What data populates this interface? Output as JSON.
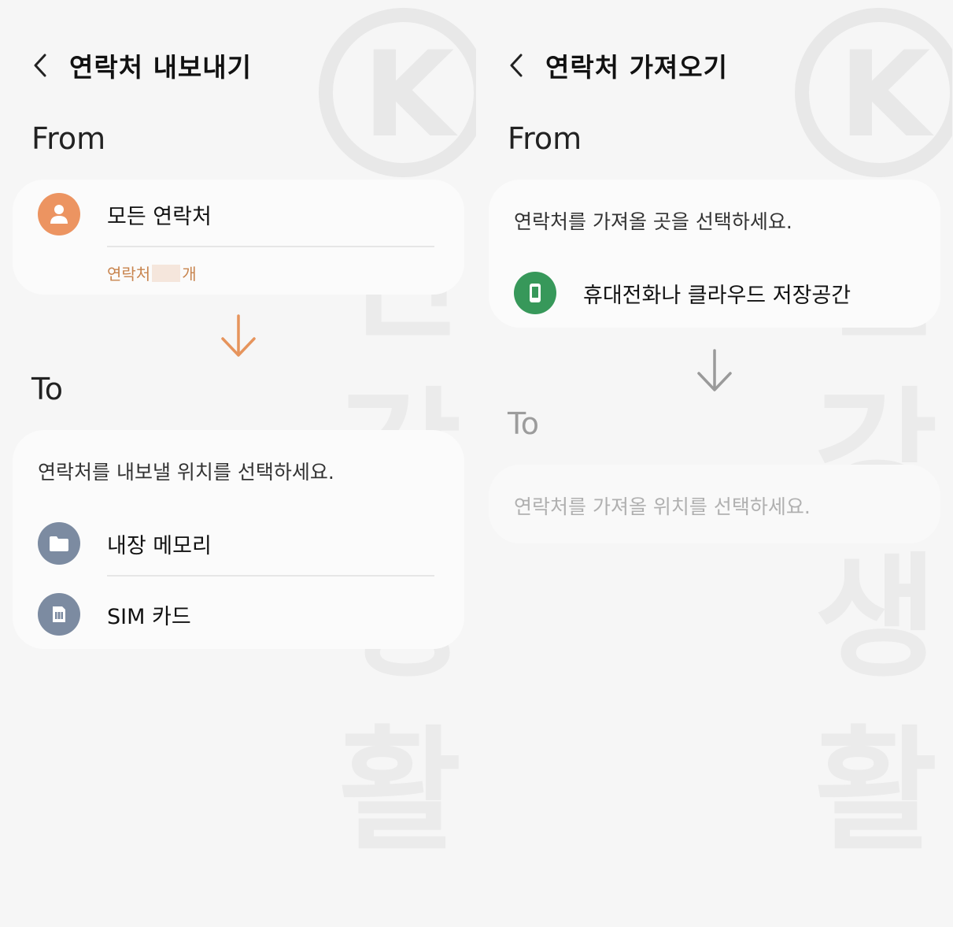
{
  "export_screen": {
    "title": "연락처 내보내기",
    "from_label": "From",
    "source_item": "모든 연락처",
    "count_prefix": "연락처",
    "count_value": "",
    "count_suffix": "개",
    "to_label": "To",
    "to_prompt": "연락처를 내보낼 위치를 선택하세요.",
    "targets": [
      {
        "label": "내장 메모리",
        "icon": "folder-icon"
      },
      {
        "label": "SIM 카드",
        "icon": "sim-card-icon"
      }
    ]
  },
  "import_screen": {
    "title": "연락처 가져오기",
    "from_label": "From",
    "from_prompt": "연락처를 가져올 곳을 선택하세요.",
    "source_item": "휴대전화나 클라우드 저장공간",
    "to_label": "To",
    "to_prompt": "연락처를 가져올 위치를 선택하세요."
  },
  "watermark": {
    "letter": "K",
    "chars": [
      "건",
      "강",
      "생",
      "활"
    ]
  },
  "colors": {
    "background": "#f6f6f6",
    "card": "#fbfbfb",
    "accent_orange": "#ec9461",
    "count_text": "#c8844e",
    "icon_gray": "#7c8ba1",
    "icon_green": "#37985a",
    "arrow_gray": "#9a9a9a"
  }
}
